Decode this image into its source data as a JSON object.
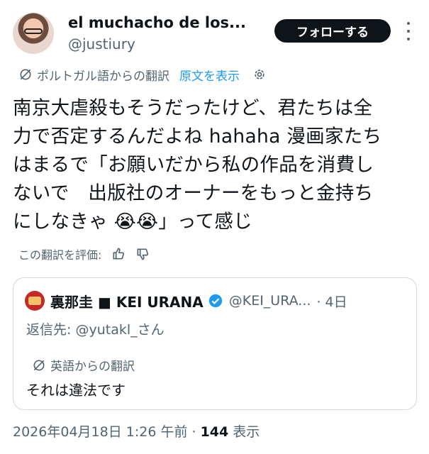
{
  "author": {
    "display_name": "el muchacho de los...",
    "handle": "@justiury"
  },
  "follow_label": "フォローする",
  "translation": {
    "label": "ポルトガル語からの翻訳",
    "show_original": "原文を表示"
  },
  "tweet": {
    "lines": [
      "南京大虐殺もそうだったけど、君たちは全",
      "力で否定するんだよね hahaha 漫画家たち",
      "はまるで「お願いだから私の作品を消費し",
      "ないで　出版社のオーナーをもっと金持ち",
      "にしなきゃ 😭😭」って感じ"
    ]
  },
  "rate_label": "この翻訳を評価:",
  "quote": {
    "name": "裏那圭 ■ KEI URANA",
    "handle": "@KEI_URA...",
    "time": "· 4日",
    "reply_prefix": "返信先: ",
    "reply_mention": "@yutakl_さん",
    "translate_label": "英語からの翻訳",
    "text": "それは違法です"
  },
  "meta": {
    "timestamp": "2026年04月18日 1:26 午前",
    "separator": " · ",
    "views_count": "144",
    "views_label": " 表示"
  },
  "colors": {
    "link": "#1d9bf0",
    "secondary_text": "#536471",
    "follow_bg": "#0f1419",
    "verified": "#1d9bf0"
  },
  "icons": [
    "translate-globe-icon",
    "gear-icon",
    "thumbs-up-icon",
    "thumbs-down-icon",
    "verified-badge-icon",
    "more-icon"
  ]
}
